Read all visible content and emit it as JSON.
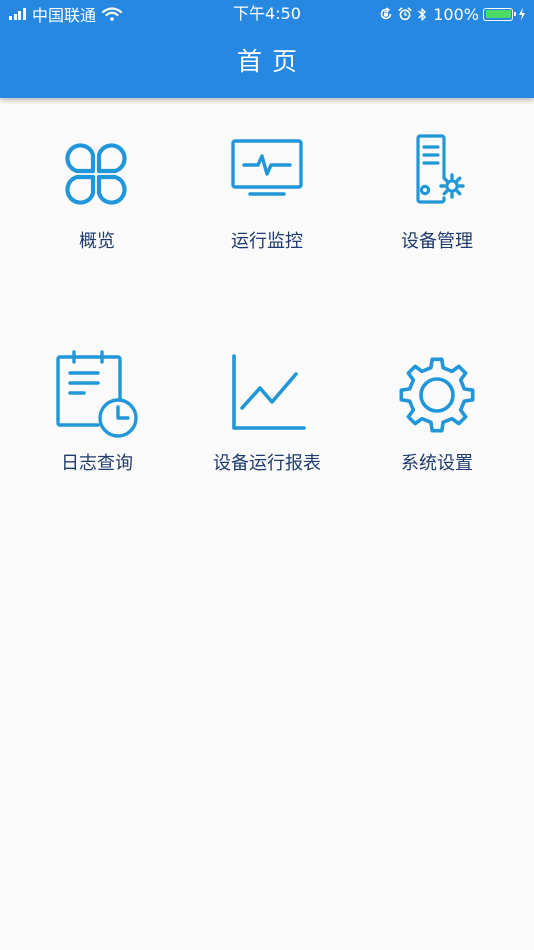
{
  "status_bar": {
    "carrier": "中国联通",
    "time": "下午4:50",
    "battery_percent": "100%",
    "battery_level": 1.0,
    "icons": [
      "signal-icon",
      "wifi-icon",
      "orientation-lock-icon",
      "alarm-icon",
      "bluetooth-icon",
      "battery-icon",
      "charging-icon"
    ]
  },
  "header": {
    "title": "首页"
  },
  "colors": {
    "header_bg": "#2788e2",
    "icon_stroke": "#2196d8",
    "label_text": "#1f3b6e",
    "page_bg": "#fafafa",
    "battery_fill": "#4cd964"
  },
  "menu": {
    "items": [
      {
        "label": "概览",
        "icon": "clover-icon"
      },
      {
        "label": "运行监控",
        "icon": "monitor-pulse-icon"
      },
      {
        "label": "设备管理",
        "icon": "server-gear-icon"
      },
      {
        "label": "日志查询",
        "icon": "log-clock-icon"
      },
      {
        "label": "设备运行报表",
        "icon": "line-chart-icon"
      },
      {
        "label": "系统设置",
        "icon": "settings-gear-icon"
      }
    ]
  }
}
